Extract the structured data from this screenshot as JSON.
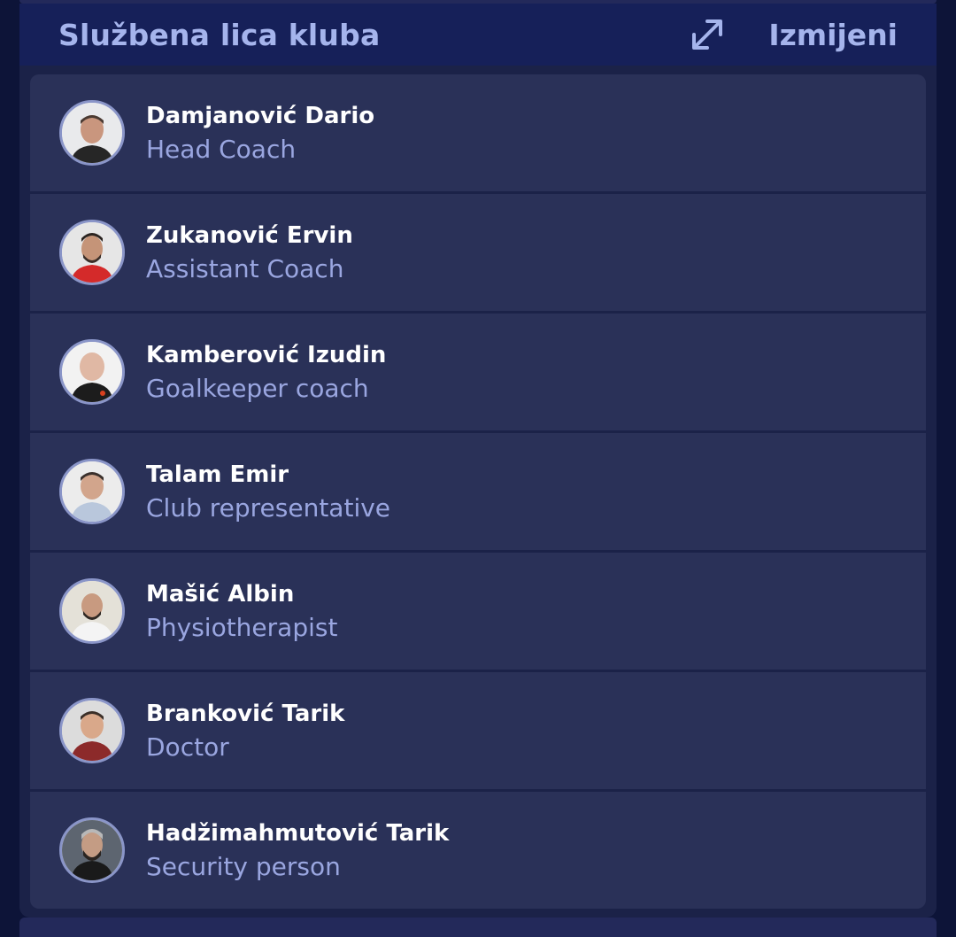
{
  "header": {
    "title": "Službena lica kluba",
    "edit_label": "Izmijeni",
    "expand_icon": "expand-arrows-icon"
  },
  "colors": {
    "background": "#0d1438",
    "header": "#162059",
    "row": "#2a3158",
    "accent_text": "#a5b4ec",
    "role_text": "#9aa6e0"
  },
  "officials": [
    {
      "name": "Damjanović Dario",
      "role": "Head Coach",
      "avatar_icon": "person-photo"
    },
    {
      "name": "Zukanović Ervin",
      "role": "Assistant Coach",
      "avatar_icon": "person-photo"
    },
    {
      "name": "Kamberović Izudin",
      "role": "Goalkeeper coach",
      "avatar_icon": "person-photo"
    },
    {
      "name": "Talam Emir",
      "role": "Club representative",
      "avatar_icon": "person-photo"
    },
    {
      "name": "Mašić Albin",
      "role": "Physiotherapist",
      "avatar_icon": "person-photo"
    },
    {
      "name": "Branković Tarik",
      "role": "Doctor",
      "avatar_icon": "person-photo"
    },
    {
      "name": "Hadžimahmutović Tarik",
      "role": "Security person",
      "avatar_icon": "person-photo"
    }
  ]
}
